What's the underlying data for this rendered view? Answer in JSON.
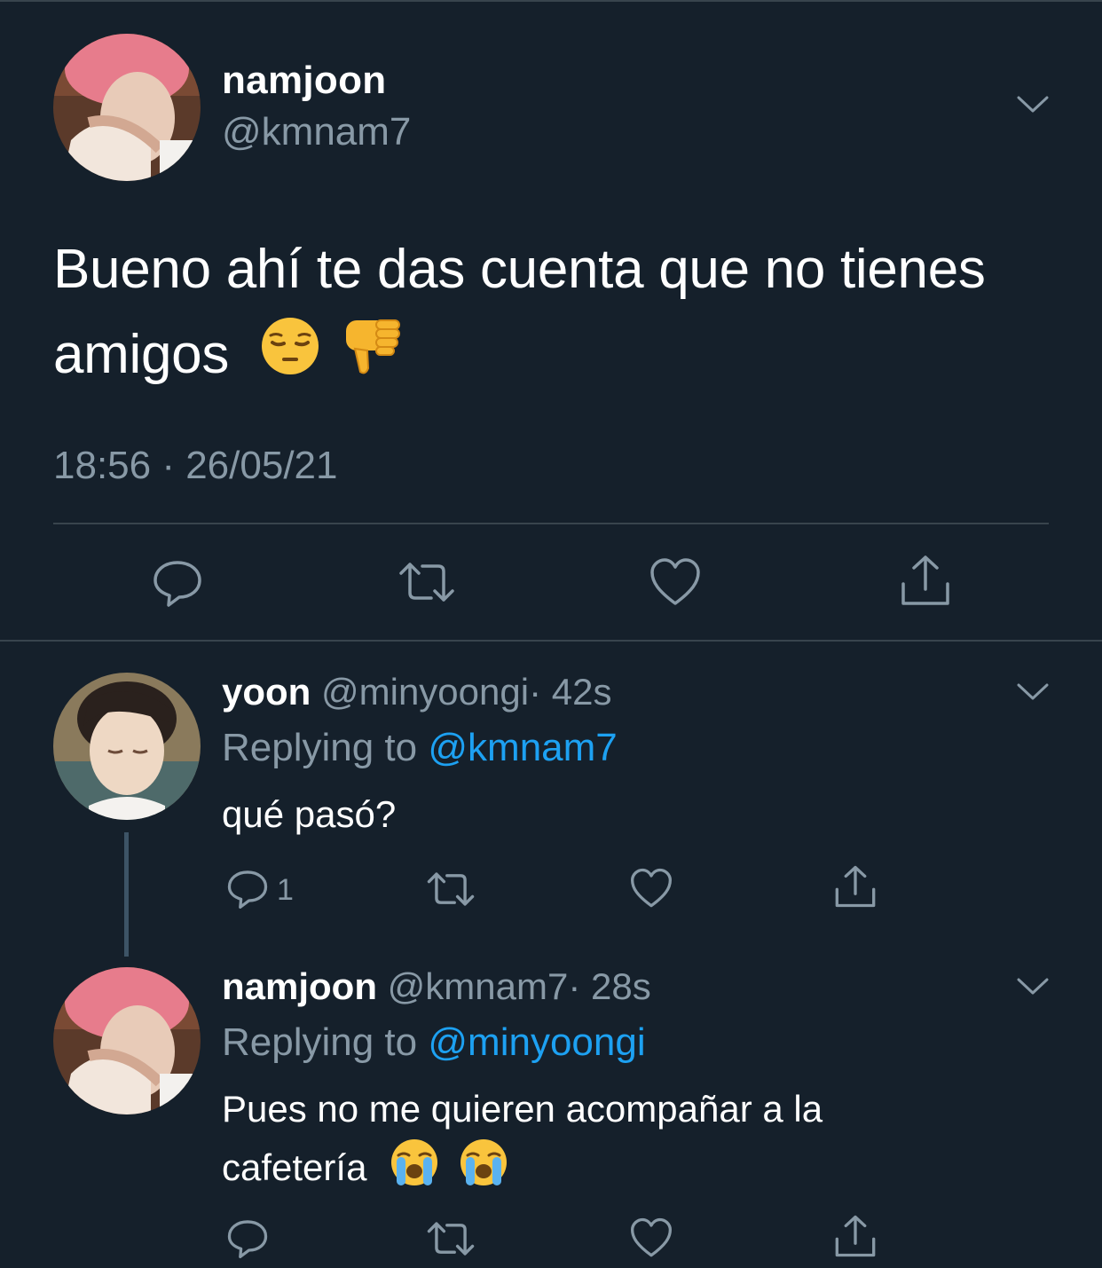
{
  "main_tweet": {
    "display_name": "namjoon",
    "handle": "@kmnam7",
    "text_line1": "Bueno ahí te das cuenta que no tienes",
    "text_line2": "amigos",
    "emojis": [
      "pensive-face",
      "thumbs-down"
    ],
    "timestamp": "18:56 · 26/05/21",
    "actions": [
      "reply-icon",
      "retweet-icon",
      "like-icon",
      "share-icon"
    ]
  },
  "replies": [
    {
      "display_name": "yoon",
      "handle": "@minyoongi",
      "time": "· 42s",
      "replying_label": "Replying to",
      "replying_to": "@kmnam7",
      "text": "qué pasó?",
      "reply_count": "1"
    },
    {
      "display_name": "namjoon",
      "handle": "@kmnam7",
      "time": "· 28s",
      "replying_label": "Replying to",
      "replying_to": "@minyoongi",
      "text_line1": "Pues no me quieren acompañar a la",
      "text_line2": "cafetería",
      "emojis": [
        "loudly-crying-face",
        "loudly-crying-face"
      ]
    }
  ],
  "colors": {
    "background": "#15202b",
    "secondary_text": "#8899a6",
    "link": "#1da1f2",
    "divider": "#38444d"
  }
}
